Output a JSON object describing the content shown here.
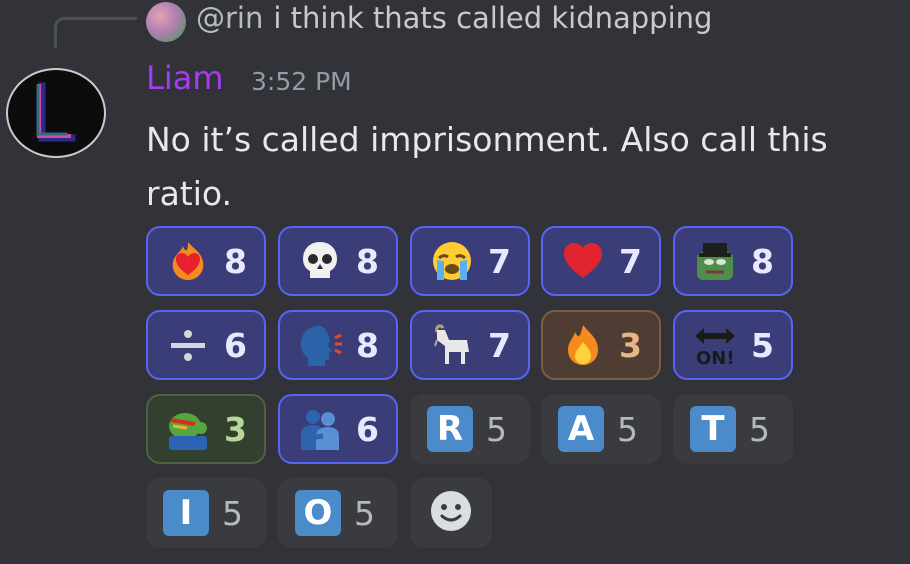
{
  "reply": {
    "mention": "@rin",
    "text": "i think thats called kidnapping"
  },
  "message": {
    "username": "Liam",
    "timestamp": "3:52 PM",
    "text": "No it’s called imprisonment. Also call this ratio."
  },
  "reactions": [
    {
      "emoji": "heart-on-fire-icon",
      "count": "8",
      "state": "active"
    },
    {
      "emoji": "skull-icon",
      "count": "8",
      "state": "active"
    },
    {
      "emoji": "crying-face-icon",
      "count": "7",
      "state": "active"
    },
    {
      "emoji": "red-heart-icon",
      "count": "7",
      "state": "active"
    },
    {
      "emoji": "pepe-tophat-icon",
      "count": "8",
      "state": "active"
    },
    {
      "emoji": "divide-icon",
      "count": "6",
      "state": "active"
    },
    {
      "emoji": "speaking-head-icon",
      "count": "8",
      "state": "active"
    },
    {
      "emoji": "goat-icon",
      "count": "7",
      "state": "active"
    },
    {
      "emoji": "fire-icon",
      "count": "3",
      "state": "orange"
    },
    {
      "emoji": "on-arrow-icon",
      "count": "5",
      "state": "active"
    },
    {
      "emoji": "pepe-angry-icon",
      "count": "3",
      "state": "green"
    },
    {
      "emoji": "people-hugging-icon",
      "count": "6",
      "state": "active"
    },
    {
      "emoji": "letter-r-icon",
      "letter": "R",
      "count": "5",
      "state": "inactive"
    },
    {
      "emoji": "letter-a-icon",
      "letter": "A",
      "count": "5",
      "state": "inactive"
    },
    {
      "emoji": "letter-t-icon",
      "letter": "T",
      "count": "5",
      "state": "inactive"
    },
    {
      "emoji": "letter-i-icon",
      "letter": "I",
      "count": "5",
      "state": "inactive"
    },
    {
      "emoji": "letter-o-icon",
      "letter": "O",
      "count": "5",
      "state": "inactive"
    }
  ],
  "add_reaction_icon": "smiley-face-icon"
}
